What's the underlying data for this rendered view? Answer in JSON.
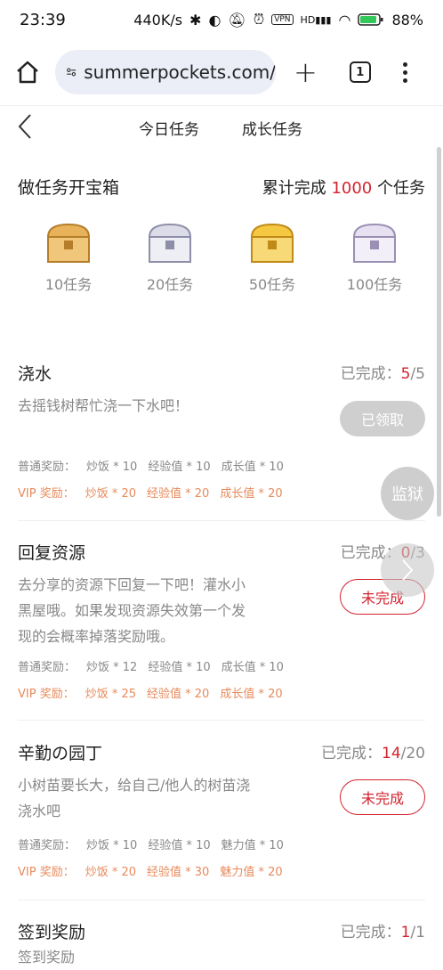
{
  "status": {
    "time": "23:39",
    "speed": "440K/s",
    "vpn": "VPN",
    "hd": "HD",
    "battery": "88%"
  },
  "browser": {
    "url": "summerpockets.com/",
    "tab_count": "1"
  },
  "nav": {
    "tab_today": "今日任务",
    "tab_growth": "成长任务"
  },
  "treasure": {
    "title": "做任务开宝箱",
    "total_prefix": "累计完成 ",
    "total_count": "1000",
    "total_suffix": " 个任务",
    "chests": [
      {
        "label": "10任务",
        "color": "#e8b25a"
      },
      {
        "label": "20任务",
        "color": "#c9c9dc"
      },
      {
        "label": "50任务",
        "color": "#f0c24a"
      },
      {
        "label": "100任务",
        "color": "#d6d0e2"
      }
    ]
  },
  "tasks": [
    {
      "name": "浇水",
      "progress_prefix": "已完成：",
      "current": "5",
      "total": "/5",
      "desc": "去摇钱树帮忙浇一下水吧！",
      "button": "已领取",
      "normal": {
        "label": "普通奖励：",
        "items": [
          "炒饭 * 10",
          "经验值 * 10",
          "成长值 * 10"
        ]
      },
      "vip": {
        "label": "VIP 奖励：",
        "items": [
          "炒饭 * 20",
          "经验值 * 20",
          "成长值 * 20"
        ]
      }
    },
    {
      "name": "回复资源",
      "progress_prefix": "已完成：",
      "current": "0",
      "total": "/3",
      "desc": "去分享的资源下回复一下吧！灌水小黑屋哦。如果发现资源失效第一个发现的会概率掉落奖励哦。",
      "button": "未完成",
      "normal": {
        "label": "普通奖励：",
        "items": [
          "炒饭 * 12",
          "经验值 * 10",
          "成长值 * 10"
        ]
      },
      "vip": {
        "label": "VIP 奖励：",
        "items": [
          "炒饭 * 25",
          "经验值 * 20",
          "成长值 * 20"
        ]
      }
    },
    {
      "name": "辛勤の园丁",
      "progress_prefix": "已完成：",
      "current": "14",
      "total": "/20",
      "desc": "小树苗要长大，给自己/他人的树苗浇浇水吧",
      "button": "未完成",
      "normal": {
        "label": "普通奖励：",
        "items": [
          "炒饭 * 10",
          "经验值 * 10",
          "魅力值 * 10"
        ]
      },
      "vip": {
        "label": "VIP 奖励：",
        "items": [
          "炒饭 * 20",
          "经验值 * 30",
          "魅力值 * 20"
        ]
      }
    },
    {
      "name": "签到奖励",
      "progress_prefix": "已完成：",
      "current": "1",
      "total": "/1",
      "desc": "签到奖励"
    }
  ],
  "floating": {
    "prison": "监狱"
  }
}
